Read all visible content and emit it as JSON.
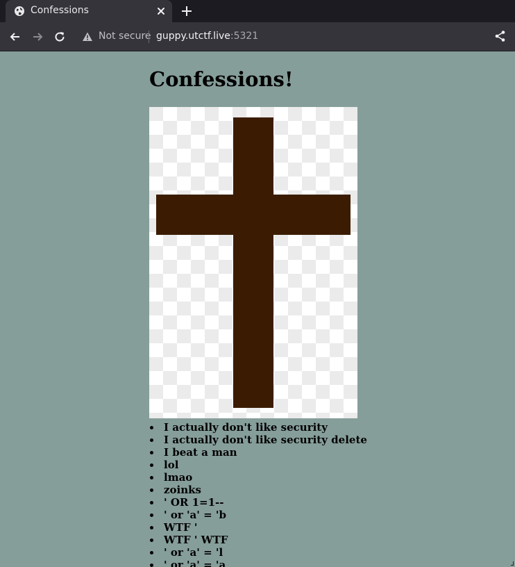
{
  "browser": {
    "tab_title": "Confessions",
    "security_label": "Not secure",
    "url_host": "guppy.utctf.live",
    "url_port": ":5321"
  },
  "page": {
    "heading": "Confessions!",
    "confessions": [
      "I actually don't like security",
      "I actually don't like security delete",
      "I beat a man",
      "lol",
      "lmao",
      "zoinks",
      "' OR 1=1--",
      "' or 'a' = 'b",
      "WTF '",
      "WTF ' WTF",
      "' or 'a' = 'l",
      "' or 'a' = 'a"
    ]
  },
  "colors": {
    "page_background": "#869e9a",
    "cross": "#3b1c02",
    "checker_light": "#ffffff",
    "checker_dark": "#ebebeb"
  },
  "icons": [
    "globe-icon",
    "close-icon",
    "plus-icon",
    "back-arrow-icon",
    "forward-arrow-icon",
    "reload-icon",
    "warning-icon",
    "share-icon"
  ]
}
